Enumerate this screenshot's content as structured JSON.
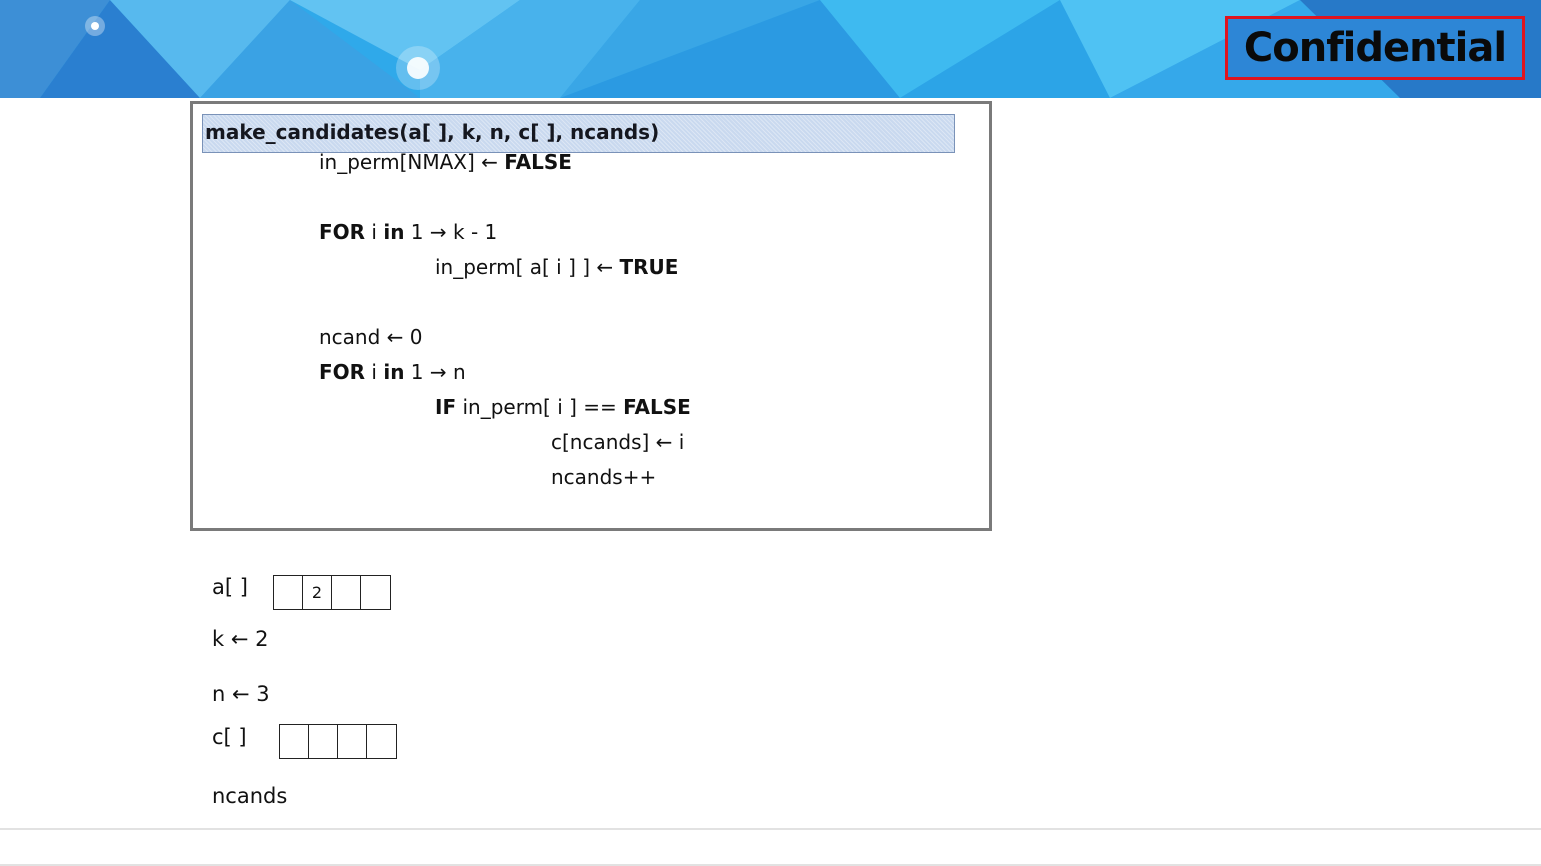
{
  "banner": {
    "badge_text": "Confidential",
    "colors": {
      "sky": "#2fa9ea",
      "badge_border": "#e0141e",
      "badge_fill": "#2d86d6"
    }
  },
  "code": {
    "signature": "make_candidates(a[ ], k, n, c[ ], ncands)",
    "lines": [
      {
        "pre": "in_perm[NMAX] ← ",
        "kw": "FALSE"
      },
      {
        "kw1": "FOR",
        "mid1": " i ",
        "kw2": "in",
        "mid2": " 1 → k - 1"
      },
      {
        "pre": "in_perm[ a[ i ] ] ← ",
        "kw": "TRUE"
      },
      {
        "text": "ncand ← 0"
      },
      {
        "kw1": "FOR",
        "mid1": "  i ",
        "kw2": "in",
        "mid2": " 1 → n"
      },
      {
        "kw1": "IF",
        "mid1": " in_perm[ i ] == ",
        "kw2": "FALSE"
      },
      {
        "text": "c[ncands] ← i"
      },
      {
        "text": "ncands++"
      }
    ]
  },
  "vars": {
    "a_label": "a[ ]",
    "a_cells": [
      "",
      "2",
      "",
      ""
    ],
    "k_label": "k ← 2",
    "n_label": "n ← 3",
    "c_label": "c[ ]",
    "c_cells": [
      "",
      "",
      "",
      ""
    ],
    "ncands_label": "ncands"
  }
}
